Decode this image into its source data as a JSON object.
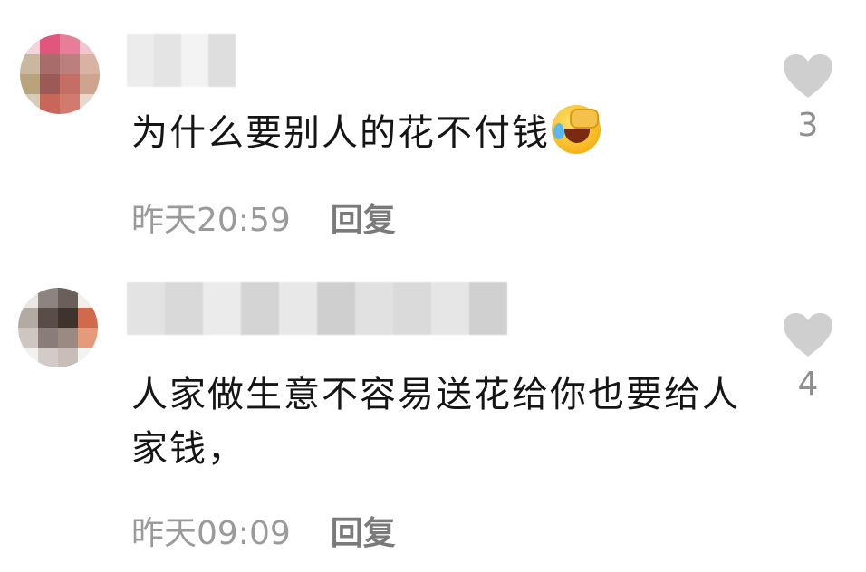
{
  "comments": [
    {
      "content": "为什么要别人的花不付钱",
      "emoji": "face-with-hand-over-mouth-tears-emoji",
      "time": "昨天20:59",
      "reply_label": "回复",
      "likes": "3"
    },
    {
      "content": "人家做生意不容易送花给你也要给人家钱，",
      "time": "昨天09:09",
      "reply_label": "回复",
      "likes": "4"
    }
  ],
  "colors": {
    "text": "#151515",
    "meta": "#9a9a9a",
    "heart": "#cfcfcf"
  },
  "icons": {
    "like": "heart-icon"
  }
}
